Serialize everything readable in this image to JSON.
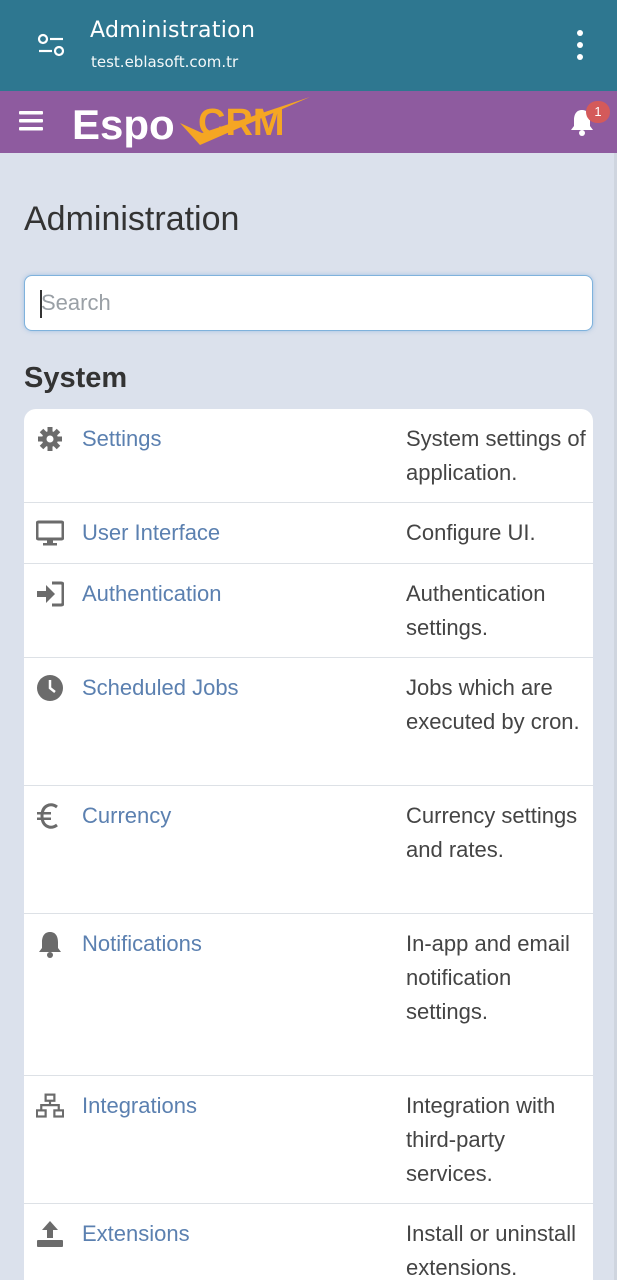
{
  "app_bar": {
    "title": "Administration",
    "subtitle": "test.eblasoft.com.tr",
    "bg": "#2e7790"
  },
  "navbar": {
    "logo_text_espo": "Espo",
    "logo_text_crm": "CRM",
    "notification_count": "1",
    "bg": "#8e5b9f"
  },
  "page": {
    "title": "Administration",
    "search_placeholder": "Search",
    "section_title": "System"
  },
  "items": [
    {
      "icon": "gear-icon",
      "label": "Settings",
      "description": "System settings of application."
    },
    {
      "icon": "monitor-icon",
      "label": "User Interface",
      "description": "Configure UI."
    },
    {
      "icon": "sign-in-icon",
      "label": "Authentication",
      "description": "Authentication settings."
    },
    {
      "icon": "clock-icon",
      "label": "Scheduled Jobs",
      "description": "Jobs which are executed by cron."
    },
    {
      "icon": "euro-icon",
      "label": "Currency",
      "description": "Currency settings and rates."
    },
    {
      "icon": "bell-icon",
      "label": "Notifications",
      "description": "In-app and email notification settings."
    },
    {
      "icon": "sitemap-icon",
      "label": "Integrations",
      "description": "Integration with third-party services."
    },
    {
      "icon": "upload-icon",
      "label": "Extensions",
      "description": "Install or uninstall extensions."
    }
  ],
  "colors": {
    "link": "#5b80b0",
    "background": "#dbe1ec",
    "badge": "#d45a5a"
  }
}
